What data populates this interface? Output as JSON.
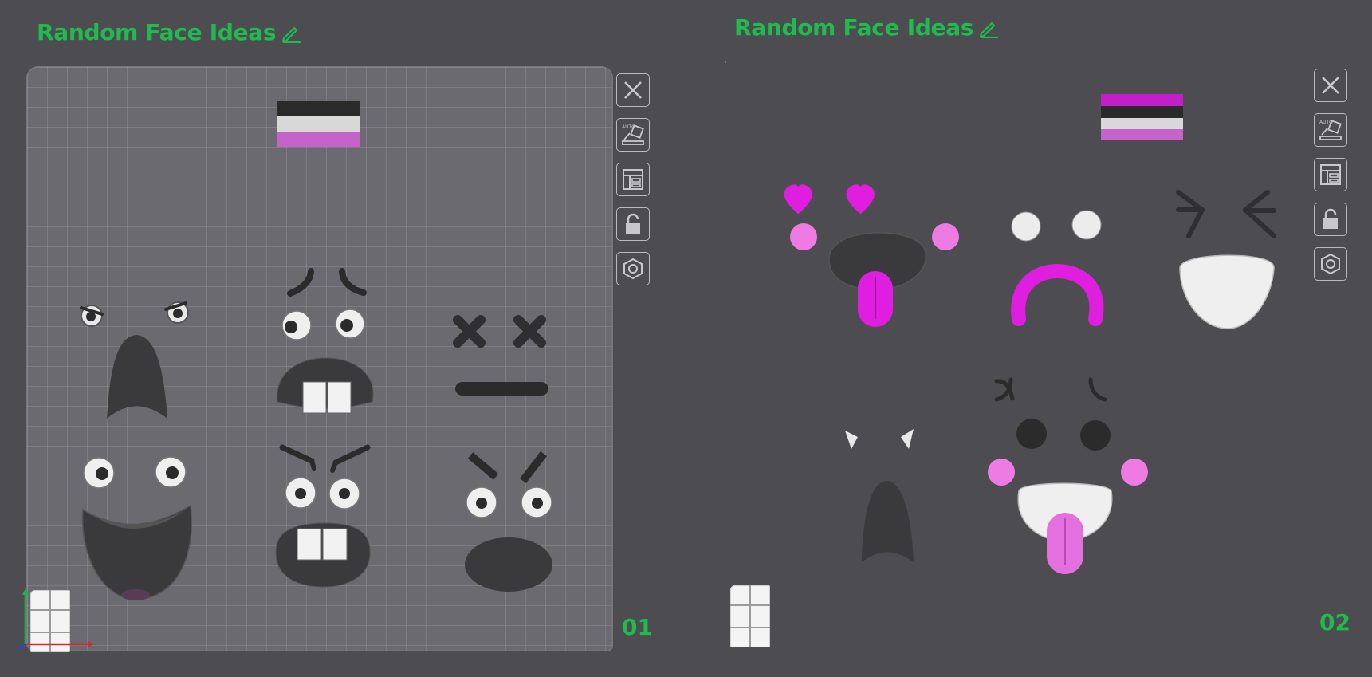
{
  "plates": [
    {
      "title": "Random Face Ideas",
      "number": "01",
      "edit_icon": "pencil-icon",
      "flag_colors": [
        "#2a2a2a",
        "#d8d8d8",
        "#c563c8"
      ]
    },
    {
      "title": "Random Face Ideas",
      "number": "02",
      "edit_icon": "pencil-icon",
      "flag_colors": [
        "#c21fc8",
        "#2a2a2a",
        "#d8d8d8",
        "#c563c8"
      ]
    }
  ],
  "toolbar": {
    "items": [
      {
        "icon": "close-icon"
      },
      {
        "icon": "auto-arrange-icon",
        "tag": "AUTO"
      },
      {
        "icon": "layout-icon"
      },
      {
        "icon": "lock-icon"
      },
      {
        "icon": "settings-hex-icon"
      }
    ]
  },
  "colors": {
    "title_green": "#1fbb4f",
    "background": "#4d4d51",
    "plate": "#6a6a70",
    "face_dark": "#3a3a3c",
    "magenta": "#e01ee0",
    "pink_cheek": "#ee7ae4"
  }
}
